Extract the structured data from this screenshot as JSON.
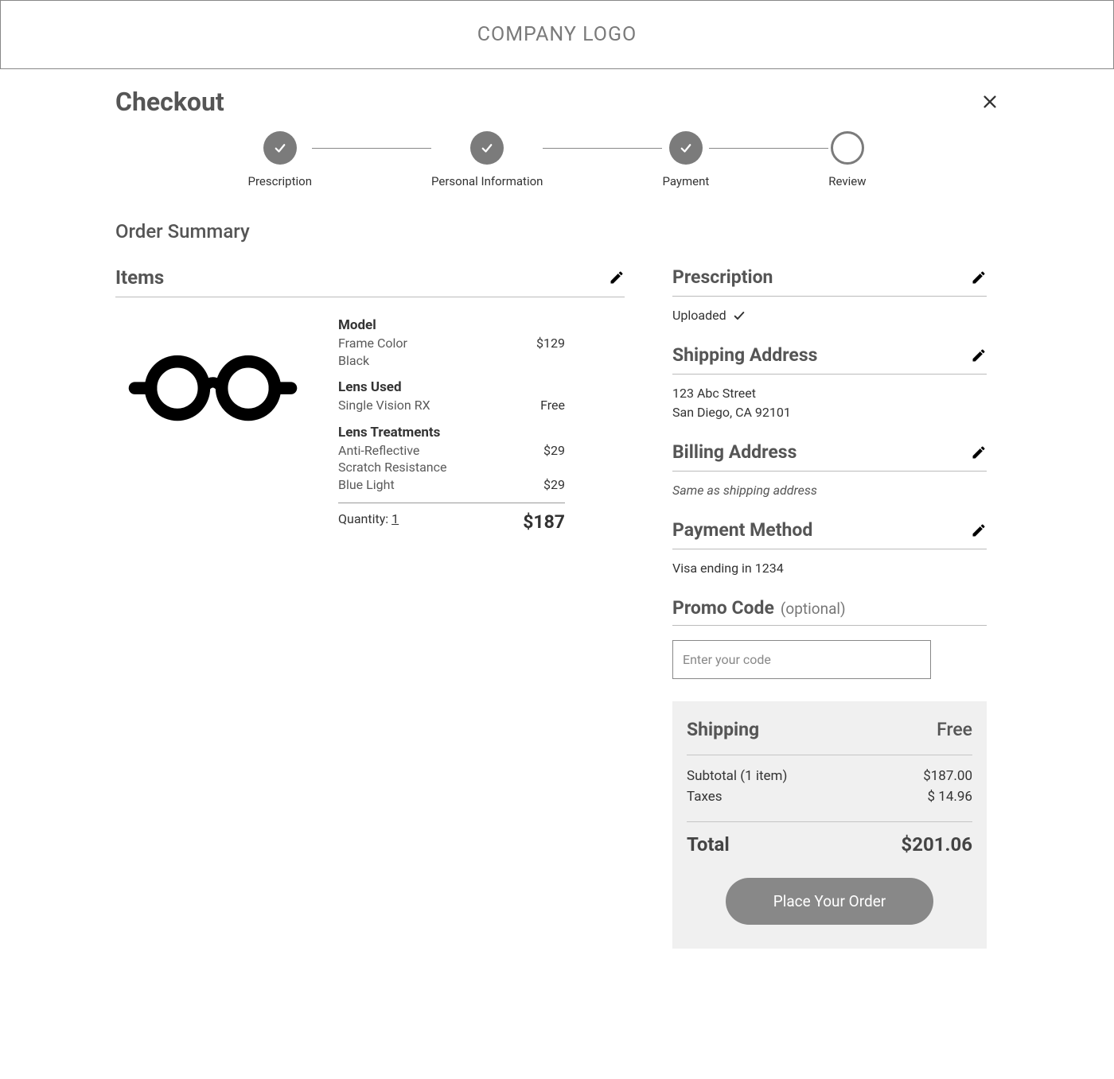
{
  "header": {
    "logo": "COMPANY LOGO"
  },
  "page": {
    "title": "Checkout",
    "order_summary_heading": "Order Summary"
  },
  "stepper": {
    "steps": [
      {
        "label": "Prescription",
        "done": true
      },
      {
        "label": "Personal Information",
        "done": true
      },
      {
        "label": "Payment",
        "done": true
      },
      {
        "label": "Review",
        "done": false
      }
    ]
  },
  "items": {
    "heading": "Items",
    "product": {
      "model_label": "Model",
      "frame_color_label": "Frame Color",
      "frame_color_value": "Black",
      "model_price": "$129",
      "lens_used_label": "Lens Used",
      "lens_used_value": "Single Vision RX",
      "lens_used_price": "Free",
      "treatments_label": "Lens Treatments",
      "treatments": [
        {
          "name": "Anti-Reflective",
          "price": "$29"
        },
        {
          "name": "Scratch Resistance",
          "price": ""
        },
        {
          "name": "Blue Light",
          "price": "$29"
        }
      ],
      "quantity_label": "Quantity:",
      "quantity_value": "1",
      "item_total": "$187"
    }
  },
  "prescription": {
    "heading": "Prescription",
    "status": "Uploaded"
  },
  "shipping": {
    "heading": "Shipping Address",
    "line1": "123 Abc Street",
    "line2": "San Diego, CA 92101"
  },
  "billing": {
    "heading": "Billing Address",
    "text": "Same as shipping address"
  },
  "payment_method": {
    "heading": "Payment Method",
    "text": "Visa ending in 1234"
  },
  "promo": {
    "heading": "Promo Code",
    "optional": "(optional)",
    "placeholder": "Enter your code"
  },
  "totals": {
    "shipping_label": "Shipping",
    "shipping_value": "Free",
    "subtotal_label": "Subtotal (1 item)",
    "subtotal_value": "$187.00",
    "taxes_label": "Taxes",
    "taxes_value": "$ 14.96",
    "total_label": "Total",
    "total_value": "$201.06",
    "place_order": "Place Your Order"
  }
}
